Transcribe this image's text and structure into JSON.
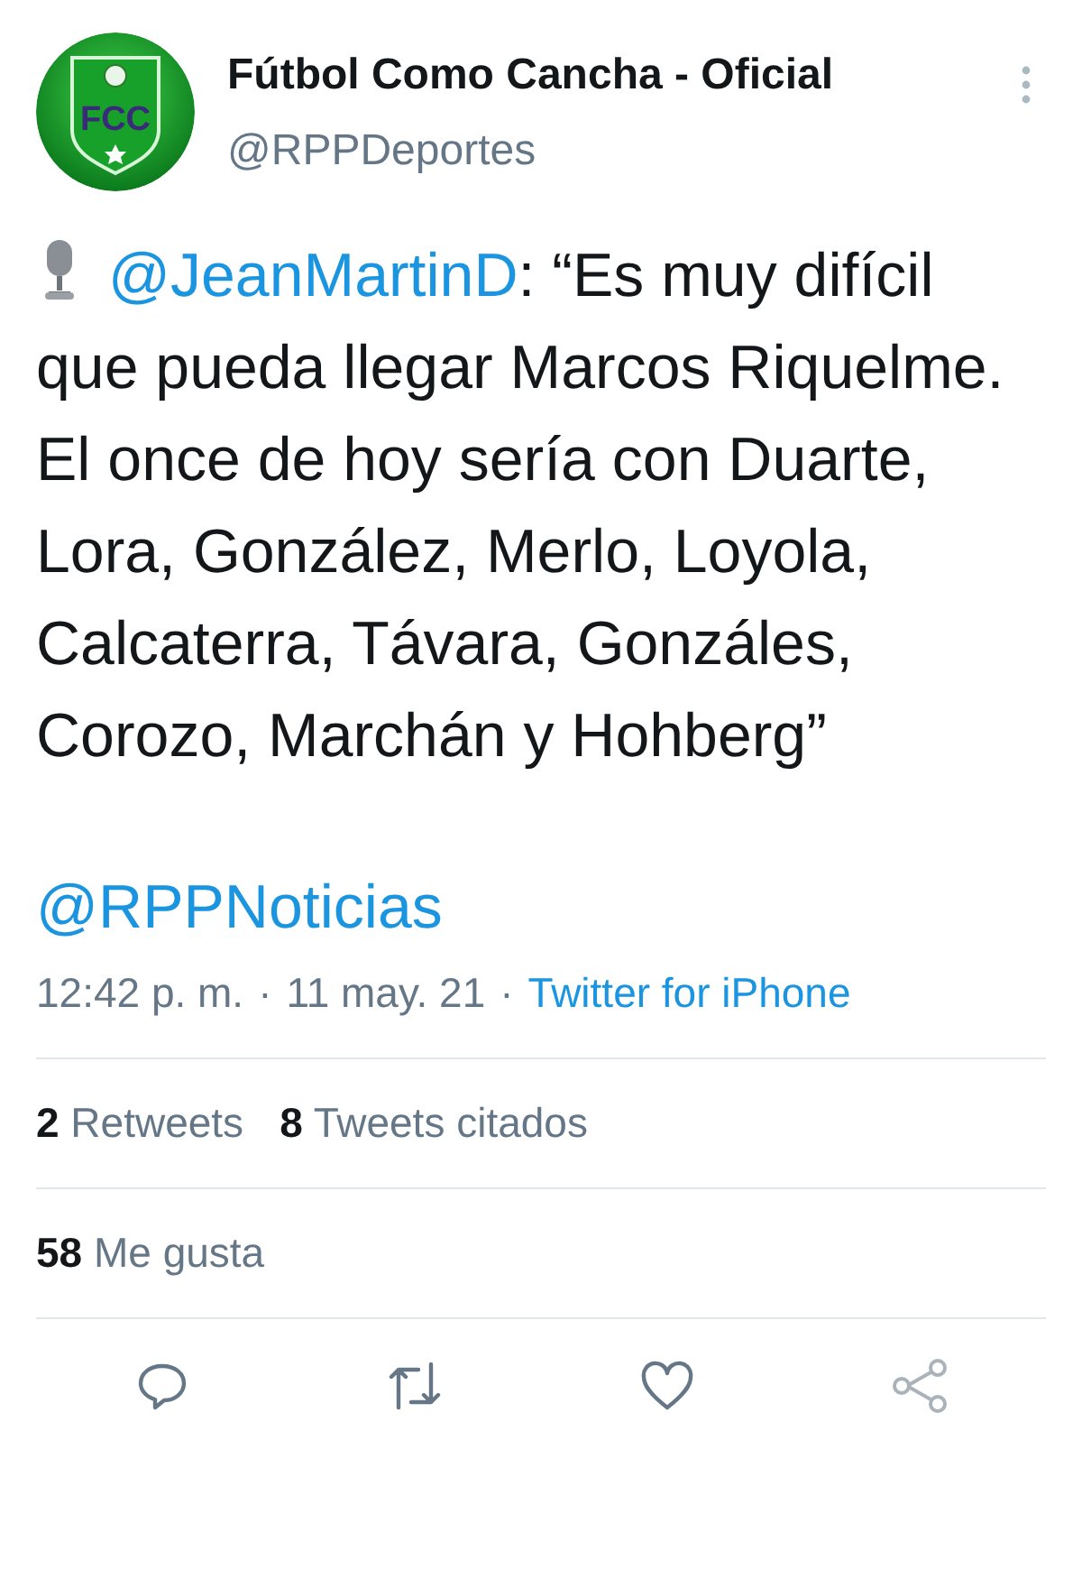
{
  "author": {
    "logo_text": "FCC",
    "name": "Fútbol Como Cancha - Oficial",
    "handle": "@RPPDeportes"
  },
  "tweet": {
    "mention": "@JeanMartinD",
    "text": ": “Es muy difícil que pueda llegar Marcos Riquelme. El once de hoy sería con Duarte, Lora, González, Merlo, Loyola, Calcaterra, Távara, Gonzáles, Corozo, Marchán y Hohberg”",
    "tag": "@RPPNoticias"
  },
  "meta": {
    "time": "12:42 p. m.",
    "separator_1": "·",
    "date": "11 may. 21",
    "separator_2": "·",
    "source": "Twitter for iPhone"
  },
  "stats": [
    {
      "text": "**2** Retweets"
    },
    {
      "text": "**8** Tweets citados"
    }
  ],
  "likes": {
    "text": "**58** Me gusta"
  },
  "actions": [
    {
      "kind": "reply"
    },
    {
      "kind": "retweet"
    },
    {
      "kind": "like"
    },
    {
      "kind": "share"
    }
  ]
}
